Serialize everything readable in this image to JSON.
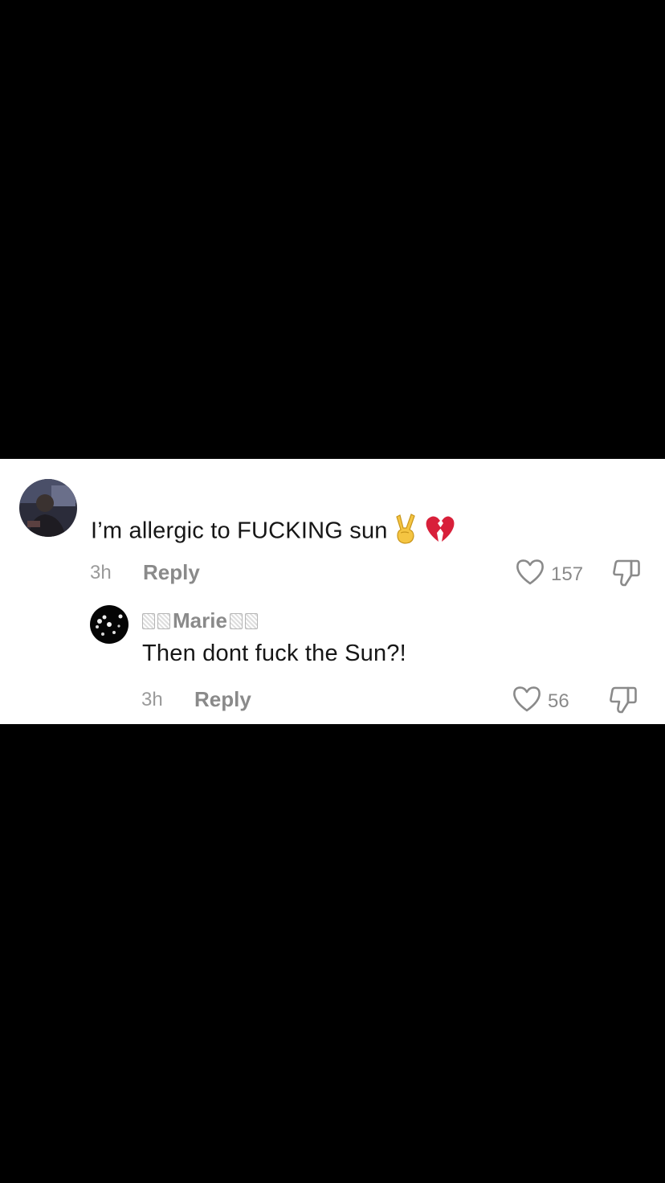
{
  "comments": [
    {
      "text": "I’m allergic to FUCKING sun",
      "emojis": [
        "victory-hand-icon",
        "broken-heart-icon"
      ],
      "time": "3h",
      "reply_label": "Reply",
      "likes": "157"
    }
  ],
  "replies": [
    {
      "username": "Marie",
      "text": "Then dont fuck the Sun?!",
      "time": "3h",
      "reply_label": "Reply",
      "likes": "56"
    }
  ],
  "colors": {
    "panel_background": "#ffffff",
    "page_background": "#000000",
    "primary_text": "#161616",
    "secondary_text": "#8a8a8a"
  }
}
